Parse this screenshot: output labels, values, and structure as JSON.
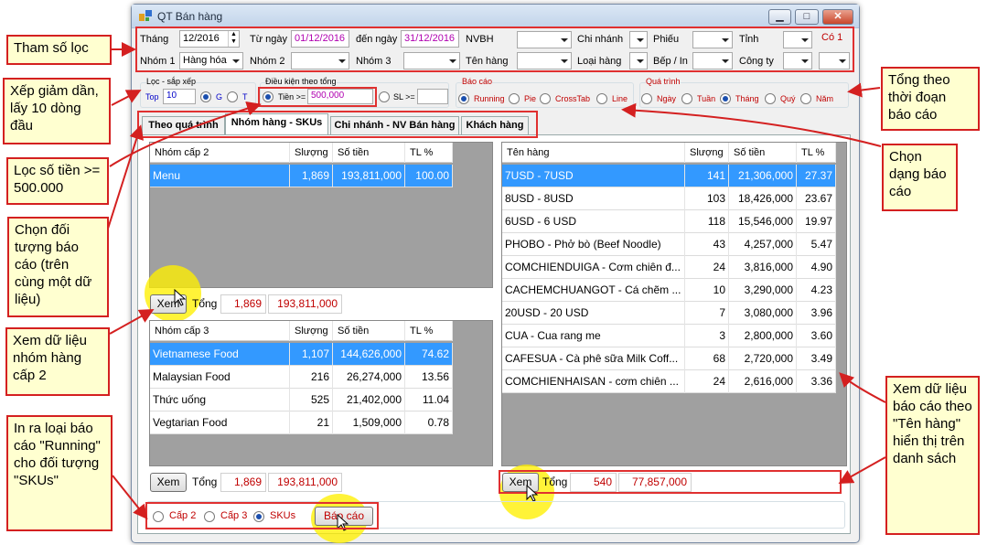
{
  "window": {
    "title": "QT Bán hàng",
    "minimize": "▁",
    "maximize": "□",
    "close": "✕"
  },
  "filters": {
    "thang_label": "Tháng",
    "thang_value": "12/2016",
    "tungay_label": "Từ ngày",
    "tungay_value": "01/12/2016",
    "denngay_label": "đến ngày",
    "denngay_value": "31/12/2016",
    "nvbh_label": "NVBH",
    "chinhanh_label": "Chi nhánh",
    "phieu_label": "Phiếu",
    "tinh_label": "Tỉnh",
    "co1_label": "Có 1",
    "nhom1_label": "Nhóm 1",
    "nhom1_value": "Hàng hóa",
    "nhom2_label": "Nhóm 2",
    "nhom3_label": "Nhóm 3",
    "tenhang_label": "Tên hàng",
    "loaihang_label": "Loại hàng",
    "bepin_label": "Bếp / In",
    "congty_label": "Công ty"
  },
  "sort": {
    "group_label": "Lọc - sắp xếp",
    "top_label": "Top",
    "top_value": "10",
    "g_label": "G",
    "t_label": "T"
  },
  "condition": {
    "group_label": "Điều kiện theo tổng",
    "tien_label": "Tiền >=",
    "tien_value": "500,000",
    "sl_label": "SL >="
  },
  "report_type": {
    "group_label": "Báo cáo",
    "options": [
      "Running",
      "Pie",
      "CrossTab",
      "Line"
    ]
  },
  "period": {
    "group_label": "Quá trình",
    "options": [
      "Ngày",
      "Tuần",
      "Tháng",
      "Quý",
      "Năm"
    ]
  },
  "tabs": [
    "Theo quá trình",
    "Nhóm hàng - SKUs",
    "Chi nhánh - NV Bán hàng",
    "Khách hàng"
  ],
  "grid_group2": {
    "headers": [
      "Nhóm cấp 2",
      "Slượng",
      "Số tiền",
      "TL %"
    ],
    "rows": [
      [
        "Menu",
        "1,869",
        "193,811,000",
        "100.00"
      ]
    ]
  },
  "sum1": {
    "button": "Xem",
    "label": "Tổng",
    "qty": "1,869",
    "amount": "193,811,000"
  },
  "grid_group3": {
    "headers": [
      "Nhóm cấp 3",
      "Slượng",
      "Số tiền",
      "TL %"
    ],
    "rows": [
      [
        "Vietnamese Food",
        "1,107",
        "144,626,000",
        "74.62"
      ],
      [
        "Malaysian Food",
        "216",
        "26,274,000",
        "13.56"
      ],
      [
        "Thức uống",
        "525",
        "21,402,000",
        "11.04"
      ],
      [
        "Vegtarian Food",
        "21",
        "1,509,000",
        "0.78"
      ]
    ]
  },
  "sum2": {
    "button": "Xem",
    "label": "Tổng",
    "qty": "1,869",
    "amount": "193,811,000"
  },
  "grid_items": {
    "headers": [
      "Tên hàng",
      "Slượng",
      "Số tiền",
      "TL %"
    ],
    "rows": [
      [
        "7USD - 7USD",
        "141",
        "21,306,000",
        "27.37"
      ],
      [
        "8USD - 8USD",
        "103",
        "18,426,000",
        "23.67"
      ],
      [
        "6USD - 6 USD",
        "118",
        "15,546,000",
        "19.97"
      ],
      [
        "PHOBO - Phở bò (Beef Noodle)",
        "43",
        "4,257,000",
        "5.47"
      ],
      [
        "COMCHIENDUIGA - Cơm chiên đ...",
        "24",
        "3,816,000",
        "4.90"
      ],
      [
        "CACHEMCHUANGOT - Cá chẽm ...",
        "10",
        "3,290,000",
        "4.23"
      ],
      [
        "20USD - 20 USD",
        "7",
        "3,080,000",
        "3.96"
      ],
      [
        "CUA - Cua rang me",
        "3",
        "2,800,000",
        "3.60"
      ],
      [
        "CAFESUA - Cà phê sữa Milk Coff...",
        "68",
        "2,720,000",
        "3.49"
      ],
      [
        "COMCHIENHAISAN - cơm chiên ...",
        "24",
        "2,616,000",
        "3.36"
      ]
    ]
  },
  "sum3": {
    "button": "Xem",
    "label": "Tổng",
    "qty": "540",
    "amount": "77,857,000"
  },
  "bottom": {
    "cap2": "Cấp 2",
    "cap3": "Cấp 3",
    "skus": "SKUs",
    "report_button": "Báo cáo"
  },
  "notes": {
    "n1": "Tham số lọc",
    "n2": "Xếp giảm dần, lấy 10 dòng đầu",
    "n3": "Lọc số tiền >= 500.000",
    "n4": "Chọn đối tượng báo cáo (trên cùng một dữ liệu)",
    "n5": "Xem dữ liệu nhóm hàng cấp 2",
    "n6": "In ra loại báo cáo \"Running\" cho đối tượng \"SKUs\"",
    "n7": "Tổng theo thời đoạn báo cáo",
    "n8": "Chọn dạng báo cáo",
    "n9": "Xem dữ liệu báo cáo theo \"Tên hàng\" hiển thị trên danh sách"
  },
  "colors": {
    "annotation_red": "#d42020",
    "note_fill": "#ffffd0",
    "selection": "#3399ff",
    "highlight_yellow": "#fff000"
  }
}
